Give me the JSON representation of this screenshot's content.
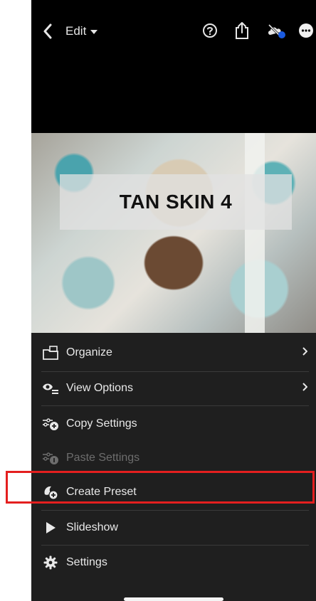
{
  "header": {
    "edit_label": "Edit"
  },
  "photo": {
    "overlay_text": "TAN SKIN 4"
  },
  "menu": {
    "items": [
      {
        "label": "Organize",
        "icon": "organize-icon",
        "has_chevron": true
      },
      {
        "label": "View Options",
        "icon": "view-options-icon",
        "has_chevron": true
      },
      {
        "label": "Copy Settings",
        "icon": "copy-settings-icon",
        "has_chevron": false
      },
      {
        "label": "Paste Settings",
        "icon": "paste-settings-icon",
        "has_chevron": false,
        "disabled": true
      },
      {
        "label": "Create Preset",
        "icon": "create-preset-icon",
        "has_chevron": false,
        "highlighted": true
      },
      {
        "label": "Slideshow",
        "icon": "play-icon",
        "has_chevron": false
      },
      {
        "label": "Settings",
        "icon": "gear-icon",
        "has_chevron": false
      }
    ]
  },
  "colors": {
    "highlight": "#e41f1f",
    "sheet": "#1f1f1f",
    "accent_dot": "#1a5adf"
  }
}
